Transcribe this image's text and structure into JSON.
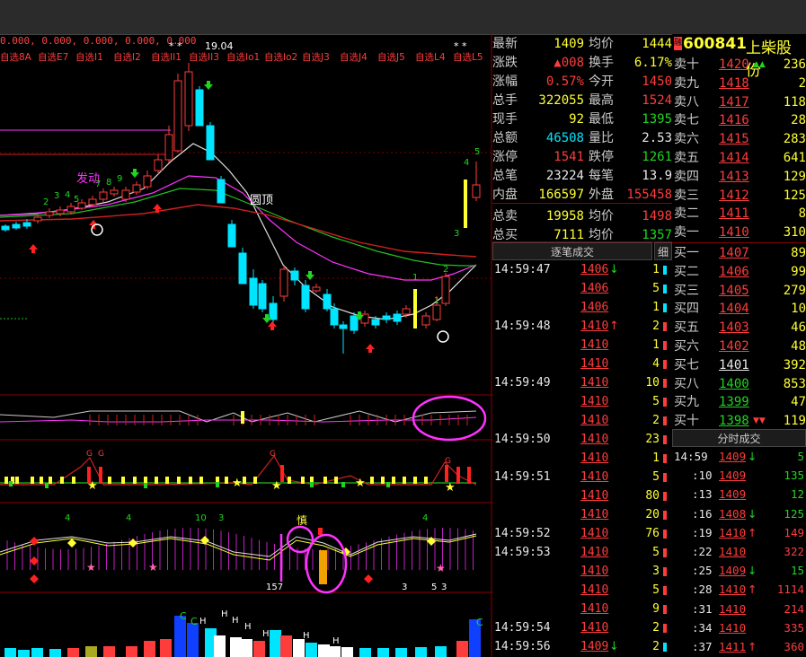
{
  "topbar": {
    "indicator_line": "0.000, 0.000, 0.000, 0.000, 0.000",
    "high_label": "19.04"
  },
  "watchlist_tabs": [
    "自选8A",
    "自选E7",
    "自选I1",
    "自选I2",
    "自选II1",
    "自选II3",
    "自选Io1",
    "自选Io2",
    "自选J3",
    "自选J4",
    "自选J5",
    "自选L4",
    "自选L5"
  ],
  "chart_labels": {
    "fa_dong": "发动",
    "yuan_ding": "圆顶",
    "shen": "慎",
    "bottom_marker": "157"
  },
  "sub_numbers": [
    "4",
    "4",
    "10",
    "3",
    "4"
  ],
  "stock": {
    "code": "600841",
    "name": "上柴股份"
  },
  "quote": [
    {
      "k1": "最新",
      "v1": "1409",
      "k2": "均价",
      "v2": "1444"
    },
    {
      "k1": "涨跌",
      "v1": "▲008",
      "k2": "换手",
      "v2": "6.17%"
    },
    {
      "k1": "涨幅",
      "v1": "0.57%",
      "k2": "今开",
      "v2": "1450"
    },
    {
      "k1": "总手",
      "v1": "322055",
      "k2": "最高",
      "v2": "1524"
    },
    {
      "k1": "现手",
      "v1": "92",
      "k2": "最低",
      "v2": "1395"
    },
    {
      "k1": "总额",
      "v1": "46508",
      "k2": "量比",
      "v2": "2.53"
    },
    {
      "k1": "涨停",
      "v1": "1541",
      "k2": "跌停",
      "v2": "1261"
    },
    {
      "k1": "总笔",
      "v1": "23224",
      "k2": "每笔",
      "v2": "13.9"
    },
    {
      "k1": "内盘",
      "v1": "166597",
      "k2": "外盘",
      "v2": "155458"
    },
    {
      "k1": "总卖",
      "v1": "19958",
      "k2": "均价",
      "v2": "1498"
    },
    {
      "k1": "总买",
      "v1": "7111",
      "k2": "均价",
      "v2": "1357"
    }
  ],
  "sell": [
    {
      "label": "卖十",
      "price": "1420",
      "mark": "▲▲",
      "vol": "236"
    },
    {
      "label": "卖九",
      "price": "1418",
      "mark": "",
      "vol": "2"
    },
    {
      "label": "卖八",
      "price": "1417",
      "mark": "",
      "vol": "118"
    },
    {
      "label": "卖七",
      "price": "1416",
      "mark": "",
      "vol": "28"
    },
    {
      "label": "卖六",
      "price": "1415",
      "mark": "",
      "vol": "283"
    },
    {
      "label": "卖五",
      "price": "1414",
      "mark": "",
      "vol": "641"
    },
    {
      "label": "卖四",
      "price": "1413",
      "mark": "",
      "vol": "129"
    },
    {
      "label": "卖三",
      "price": "1412",
      "mark": "",
      "vol": "125"
    },
    {
      "label": "卖二",
      "price": "1411",
      "mark": "",
      "vol": "8"
    },
    {
      "label": "卖一",
      "price": "1410",
      "mark": "",
      "vol": "310"
    }
  ],
  "buy": [
    {
      "label": "买一",
      "price": "1407",
      "mark": "",
      "vol": "89"
    },
    {
      "label": "买二",
      "price": "1406",
      "mark": "",
      "vol": "99"
    },
    {
      "label": "买三",
      "price": "1405",
      "mark": "",
      "vol": "279"
    },
    {
      "label": "买四",
      "price": "1404",
      "mark": "",
      "vol": "10"
    },
    {
      "label": "买五",
      "price": "1403",
      "mark": "",
      "vol": "46"
    },
    {
      "label": "买六",
      "price": "1402",
      "mark": "",
      "vol": "48"
    },
    {
      "label": "买七",
      "price": "1401",
      "mark": "",
      "vol": "392"
    },
    {
      "label": "买八",
      "price": "1400",
      "mark": "",
      "vol": "853"
    },
    {
      "label": "买九",
      "price": "1399",
      "mark": "",
      "vol": "47"
    },
    {
      "label": "买十",
      "price": "1398",
      "mark": "▼▼",
      "vol": "119"
    }
  ],
  "ticks_header": {
    "title": "逐笔成交",
    "detail": "细"
  },
  "ticks": [
    {
      "time": "14:59:47",
      "price": "1406",
      "dir": "down",
      "vol": "1",
      "vc": "cyan"
    },
    {
      "time": "",
      "price": "1406",
      "dir": "",
      "vol": "5",
      "vc": "cyan"
    },
    {
      "time": "",
      "price": "1406",
      "dir": "",
      "vol": "1",
      "vc": "cyan"
    },
    {
      "time": "14:59:48",
      "price": "1410",
      "dir": "up",
      "vol": "2",
      "vc": "red"
    },
    {
      "time": "",
      "price": "1410",
      "dir": "",
      "vol": "1",
      "vc": "red"
    },
    {
      "time": "",
      "price": "1410",
      "dir": "",
      "vol": "4",
      "vc": "red"
    },
    {
      "time": "14:59:49",
      "price": "1410",
      "dir": "",
      "vol": "10",
      "vc": "red"
    },
    {
      "time": "",
      "price": "1410",
      "dir": "",
      "vol": "5",
      "vc": "red"
    },
    {
      "time": "",
      "price": "1410",
      "dir": "",
      "vol": "2",
      "vc": "red"
    },
    {
      "time": "14:59:50",
      "price": "1410",
      "dir": "",
      "vol": "23",
      "vc": "red"
    },
    {
      "time": "",
      "price": "1410",
      "dir": "",
      "vol": "1",
      "vc": "red"
    },
    {
      "time": "14:59:51",
      "price": "1410",
      "dir": "",
      "vol": "5",
      "vc": "red"
    },
    {
      "time": "",
      "price": "1410",
      "dir": "",
      "vol": "80",
      "vc": "red"
    },
    {
      "time": "",
      "price": "1410",
      "dir": "",
      "vol": "20",
      "vc": "red"
    },
    {
      "time": "14:59:52",
      "price": "1410",
      "dir": "",
      "vol": "76",
      "vc": "red"
    },
    {
      "time": "14:59:53",
      "price": "1410",
      "dir": "",
      "vol": "5",
      "vc": "red"
    },
    {
      "time": "",
      "price": "1410",
      "dir": "",
      "vol": "3",
      "vc": "red"
    },
    {
      "time": "",
      "price": "1410",
      "dir": "",
      "vol": "5",
      "vc": "red"
    },
    {
      "time": "",
      "price": "1410",
      "dir": "",
      "vol": "9",
      "vc": "red"
    },
    {
      "time": "14:59:54",
      "price": "1410",
      "dir": "",
      "vol": "2",
      "vc": "red"
    },
    {
      "time": "14:59:56",
      "price": "1409",
      "dir": "down",
      "vol": "2",
      "vc": "cyan"
    }
  ],
  "mticks_header": {
    "title": "分时成交"
  },
  "mticks": [
    {
      "time": "14:59",
      "price": "1409",
      "dir": "down",
      "vol": "5",
      "vc": "green"
    },
    {
      "time": ":10",
      "price": "1409",
      "dir": "",
      "vol": "135",
      "vc": "green"
    },
    {
      "time": ":13",
      "price": "1409",
      "dir": "",
      "vol": "12",
      "vc": "green"
    },
    {
      "time": ":16",
      "price": "1408",
      "dir": "down",
      "vol": "125",
      "vc": "green"
    },
    {
      "time": ":19",
      "price": "1410",
      "dir": "up",
      "vol": "149",
      "vc": "red"
    },
    {
      "time": ":22",
      "price": "1410",
      "dir": "",
      "vol": "322",
      "vc": "red"
    },
    {
      "time": ":25",
      "price": "1409",
      "dir": "down",
      "vol": "15",
      "vc": "green"
    },
    {
      "time": ":28",
      "price": "1410",
      "dir": "up",
      "vol": "1114",
      "vc": "red"
    },
    {
      "time": ":31",
      "price": "1410",
      "dir": "",
      "vol": "214",
      "vc": "red"
    },
    {
      "time": ":34",
      "price": "1410",
      "dir": "",
      "vol": "335",
      "vc": "red"
    },
    {
      "time": ":37",
      "price": "1411",
      "dir": "up",
      "vol": "360",
      "vc": "red"
    }
  ],
  "colors": {
    "up": "#ff3c3c",
    "down": "#00e5ff",
    "price_yellow": "#ffff33",
    "grid": "#8a0000",
    "magenta": "#ff33ff"
  }
}
